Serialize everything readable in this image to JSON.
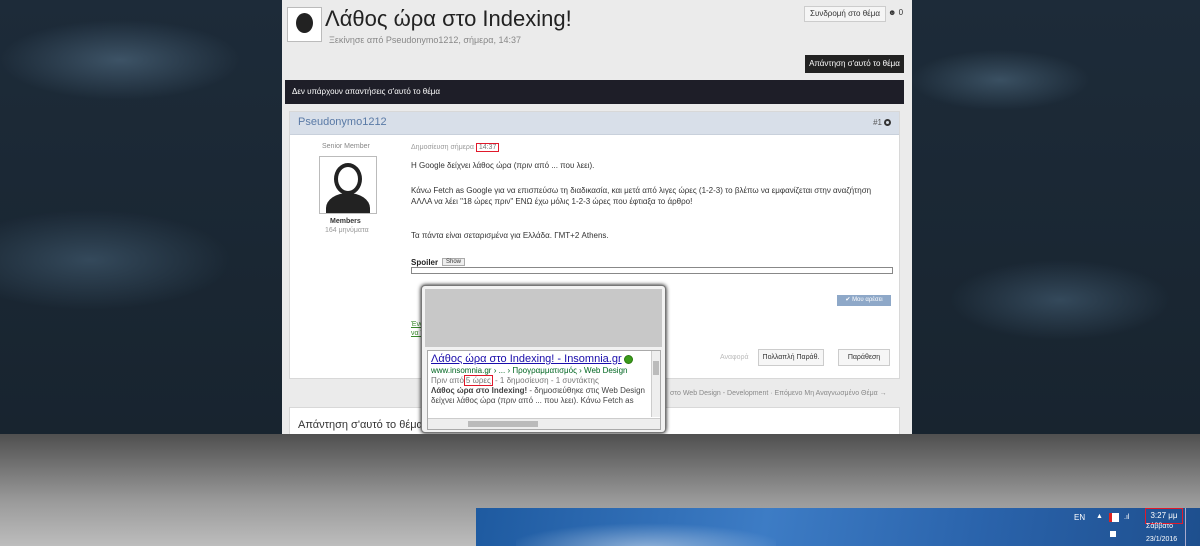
{
  "topic": {
    "title": "Λάθος ώρα στο Indexing!",
    "started_by": "Ξεκίνησε από Pseudonymo1212, σήμερα, 14:37",
    "follow_label": "Συνδρομή στο θέμα",
    "follow_count": "0",
    "reply_button": "Απάντηση σ'αυτό το θέμα",
    "no_replies": "Δεν υπάρχουν απαντήσεις σ'αυτό το θέμα"
  },
  "post": {
    "author": "Pseudonymo1212",
    "number": "#1",
    "rank": "Senior Member",
    "group": "Members",
    "post_count": "164 μηνύματα",
    "posted_prefix": "Δημοσίευση σήμερα",
    "posted_time": "14:37",
    "paragraphs": [
      "Η Google δείχνει λάθος ώρα (πριν από ... που λεει).",
      "Κάνω Fetch as Google για να επισπεύσω τη διαδικασία, και μετά από λιγες ώρες (1-2-3) το βλέπω να εμφανίζεται στην αναζήτηση ΑΛΛΑ να λέει \"18 ώρες πριν\" ΕΝΩ έχω μόλις 1-2-3 ώρες που έφτιαξα το άρθρο!",
      "Τα πάντα είναι σεταρισμένα για Ελλάδα. ΓΜΤ+2 Athens."
    ],
    "spoiler_label": "Spoiler",
    "show_label": "Show",
    "like_label": "Μου αρέσει",
    "signature_line1": "Ένα                                                          ίνως και φιλικές σελίδες) να μου στείλει μήνυμα με το Site σου ώστε",
    "signature_line2": "να Τ",
    "report_label": "Αναφορά",
    "multiquote_label": "Πολλαπλή Παράθ.",
    "quote_label": "Παράθεση"
  },
  "next_topic": "στο Web Design - Development · Επόμενο Μη Αναγνωσμένο Θέμα →",
  "reply_box_title": "Απάντηση σ'αυτό το θέμα",
  "search_result": {
    "title": "Λάθος ώρα στο Indexing! - Insomnia.gr",
    "url": "www.insomnia.gr › ... › Προγραμματισμός › Web Design",
    "meta_prefix": "Πριν από",
    "meta_highlight": "5 ώρες",
    "meta_suffix": "- 1 δημοσίευση - 1 συντάκτης",
    "snippet_bold": "Λάθος ώρα στο Indexing!",
    "snippet_rest": " - δημοσιεύθηκε στις Web Design",
    "snippet_line2": "δείχνει λάθος ώρα (πριν από ... που λεει). Κάνω Fetch as"
  },
  "taskbar": {
    "language": "EN",
    "time": "3:27 μμ",
    "day": "Σάββατο",
    "date": "23/1/2016"
  },
  "colors": {
    "highlight_red": "#e0192b",
    "link_blue": "#1a0dab",
    "url_green": "#006621"
  }
}
